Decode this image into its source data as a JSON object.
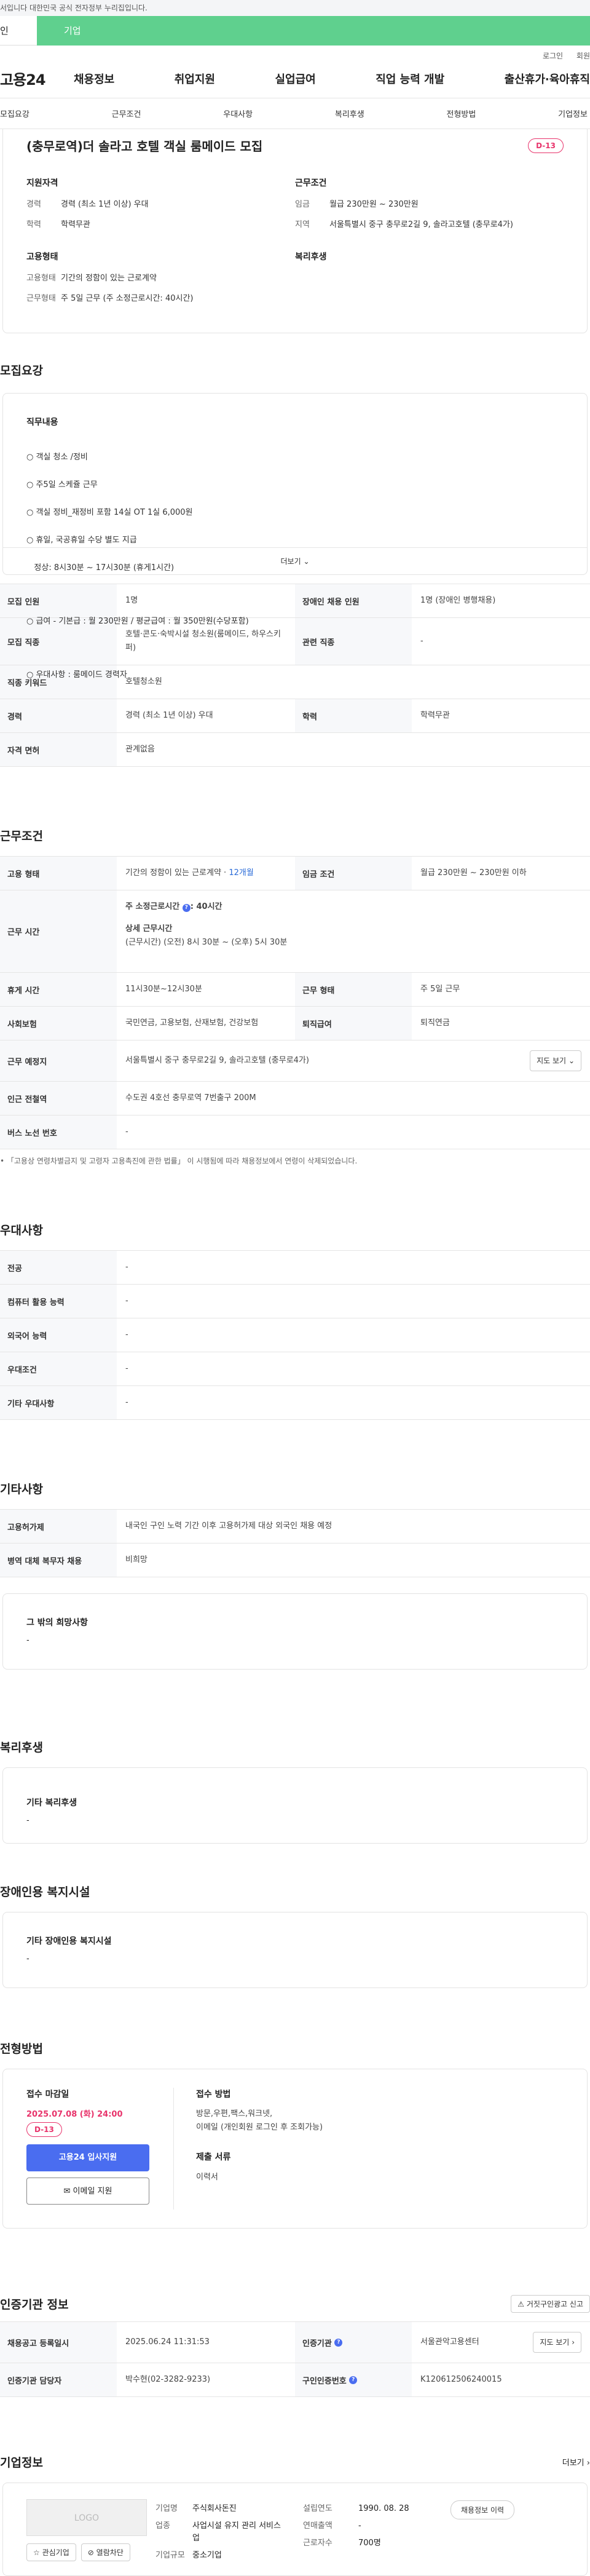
{
  "topbar": {
    "notice": "서입니다 대한민국 공식 전자정부 누리집입니다."
  },
  "tabs": {
    "individual": "인",
    "business": "기업"
  },
  "util": {
    "login": "로그인",
    "signup": "회원"
  },
  "gnb": {
    "logo": "고용24",
    "menu": [
      "채용정보",
      "취업지원",
      "실업급여",
      "직업 능력 개발",
      "출산휴가·육아휴직"
    ]
  },
  "subnav": [
    "모집요강",
    "근무조건",
    "우대사항",
    "복리후생",
    "전형방법",
    "기업정보"
  ],
  "header": {
    "title": "(충무로역)더 솔라고 호텔 객실 룸메이드 모집",
    "dday": "D-13",
    "qual_title": "지원자격",
    "qual": [
      {
        "k": "경력",
        "v": "경력 (최소 1년 이상) 우대"
      },
      {
        "k": "학력",
        "v": "학력무관"
      }
    ],
    "work_title": "근무조건",
    "work": [
      {
        "k": "임금",
        "v": "월급 230만원 ~ 230만원"
      },
      {
        "k": "지역",
        "v": "서울특별시 중구 충무로2길 9, 솔라고호텔 (충무로4가)"
      }
    ],
    "emp_title": "고용형태",
    "emp": [
      {
        "k": "고용형태",
        "v": "기간의 정함이 있는 근로계약"
      },
      {
        "k": "근무형태",
        "v": "주 5일 근무 (주 소정근로시간: 40시간)"
      }
    ],
    "welfare_title": "복리후생"
  },
  "recruit": {
    "title": "모집요강",
    "duty_title": "직무내용",
    "duty_lines": [
      "○ 객실 청소 /정비",
      "○ 주5일 스케쥴 근무",
      "○ 객실 정비_재정비 포함 14실 OT 1실 6,000원",
      "○ 휴일, 국공휴일 수당 별도 지급",
      "   정상: 8시30분 ~ 17시30분 (휴게1시간)",
      "",
      "○ 급여 - 기본급 : 월 230만원 / 평균급여 : 월 350만원(수당포함)",
      "",
      "○ 우대사항 : 룸메이드 경력자"
    ],
    "more": "더보기",
    "rows": [
      [
        {
          "k": "모집 인원",
          "v": "1명"
        },
        {
          "k": "장애인 채용 인원",
          "v": "1명 (장애인 병행채용)"
        }
      ],
      [
        {
          "k": "모집 직종",
          "v": "호텔·콘도·숙박시설 청소원(룸메이드, 하우스키퍼)"
        },
        {
          "k": "관련 직종",
          "v": "-"
        }
      ],
      [
        {
          "k": "직종 키워드",
          "v": "호텔청소원"
        }
      ],
      [
        {
          "k": "경력",
          "v": "경력 (최소 1년 이상) 우대"
        },
        {
          "k": "학력",
          "v": "학력무관"
        }
      ],
      [
        {
          "k": "자격 면허",
          "v": "관계없음"
        }
      ]
    ]
  },
  "conditions": {
    "title": "근무조건",
    "emp_type_k": "고용 형태",
    "emp_type_v": "기간의 정함이 있는 근로계약 · ",
    "emp_type_months": "12개월",
    "wage_k": "임금 조건",
    "wage_v": "월급 230만원 ~ 230만원 이하",
    "hours_k": "근무 시간",
    "hours_weekly": "주 소정근로시간 ",
    "hours_weekly_val": ": 40시간",
    "hours_detail_title": "상세 근무시간",
    "hours_detail": "(근무시간) (오전) 8시 30분 ~ (오후) 5시 30분",
    "break_k": "휴게 시간",
    "break_v": "11시30분~12시30분",
    "shift_k": "근무 형태",
    "shift_v": "주 5일 근무",
    "insurance_k": "사회보험",
    "insurance_v": "국민연금, 고용보험, 산재보험, 건강보험",
    "severance_k": "퇴직급여",
    "severance_v": "퇴직연금",
    "place_k": "근무 예정지",
    "place_v": "서울특별시 중구 충무로2길 9, 솔라고호텔 (충무로4가)",
    "map_btn": "지도 보기",
    "station_k": "인근 전철역",
    "station_v": "수도권 4호선 충무로역 7번출구 200M",
    "bus_k": "버스 노선 번호",
    "bus_v": "-",
    "note": "• 「고용상 연령차별금지 및 고령자 고용촉진에 관한 법률」 이 시행됨에 따라 채용정보에서 연령이 삭제되었습니다."
  },
  "preference": {
    "title": "우대사항",
    "rows": [
      {
        "k": "전공",
        "v": "-"
      },
      {
        "k": "컴퓨터 활용 능력",
        "v": "-"
      },
      {
        "k": "외국어 능력",
        "v": "-"
      },
      {
        "k": "우대조건",
        "v": "-"
      },
      {
        "k": "기타 우대사항",
        "v": "-"
      }
    ]
  },
  "other": {
    "title": "기타사항",
    "rows": [
      {
        "k": "고용허가제",
        "v": "내국인 구인 노력 기간 이후 고용허가제 대상 외국인 채용 예정"
      },
      {
        "k": "병역 대체 복무자 채용",
        "v": "비희망"
      }
    ],
    "box_title": "그 밖의 희망사항",
    "box_v": "-"
  },
  "welfare": {
    "title": "복리후생",
    "box_title": "기타 복리후생",
    "box_v": "-"
  },
  "disability": {
    "title": "장애인용 복지시설",
    "box_title": "기타 장애인용 복지시설",
    "box_v": "-"
  },
  "process": {
    "title": "전형방법",
    "deadline_title": "접수 마감일",
    "deadline": "2025.07.08 (화) 24:00",
    "dday": "D-13",
    "apply_btn": "고용24 입사지원",
    "email_btn": "이메일 지원",
    "method_title": "접수 방법",
    "method": "방문,우편,팩스,워크넷,",
    "method2": "이메일 (개인회원 로그인 후 조회가능)",
    "docs_title": "제출 서류",
    "docs": "이력서"
  },
  "agency": {
    "title": "인증기관 정보",
    "report_btn": "거짓구인광고 신고",
    "reg_k": "채용공고 등록일시",
    "reg_v": "2025.06.24 11:31:53",
    "org_k": "인증기관",
    "org_v": "서울관악고용센터",
    "map_btn": "지도 보기",
    "staff_k": "인증기관 담당자",
    "staff_v": "박수현(02-3282-9233)",
    "num_k": "구인인증번호",
    "num_v": "K120612506240015"
  },
  "company": {
    "title": "기업정보",
    "more": "더보기",
    "logo": "LOGO",
    "fav_btn": "관심기업",
    "block_btn": "열람차단",
    "name_k": "기업명",
    "name_v": "주식회사돈진",
    "ind_k": "업종",
    "ind_v": "사업시설 유지 관리 서비스업",
    "size_k": "기업규모",
    "size_v": "중소기업",
    "year_k": "설립연도",
    "year_v": "1990. 08. 28",
    "sales_k": "연매출액",
    "sales_v": "-",
    "emp_k": "근로자수",
    "emp_v": "700명",
    "job_btn": "채용정보 이력"
  },
  "colors": {
    "accent": "#5fd08e",
    "primary": "#4a6df0",
    "red": "#e8336b"
  }
}
